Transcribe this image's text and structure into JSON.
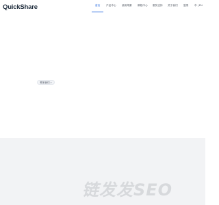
{
  "brand": {
    "logo_text": "QuickShare"
  },
  "nav": {
    "items": [
      {
        "label": "首页",
        "active": true
      },
      {
        "label": "产品中心"
      },
      {
        "label": "使用场景"
      },
      {
        "label": "教程中心"
      },
      {
        "label": "服务支持"
      },
      {
        "label": "关于我们"
      },
      {
        "label": "登录"
      }
    ],
    "language": "中 | EN"
  },
  "hero": {
    "learn_more": "联系我们 >"
  },
  "watermark": {
    "text": "链发发SEO"
  },
  "colors": {
    "accent": "#2f6fe0",
    "footer_bg": "#f2f3f5",
    "watermark": "#d7d9dc"
  }
}
